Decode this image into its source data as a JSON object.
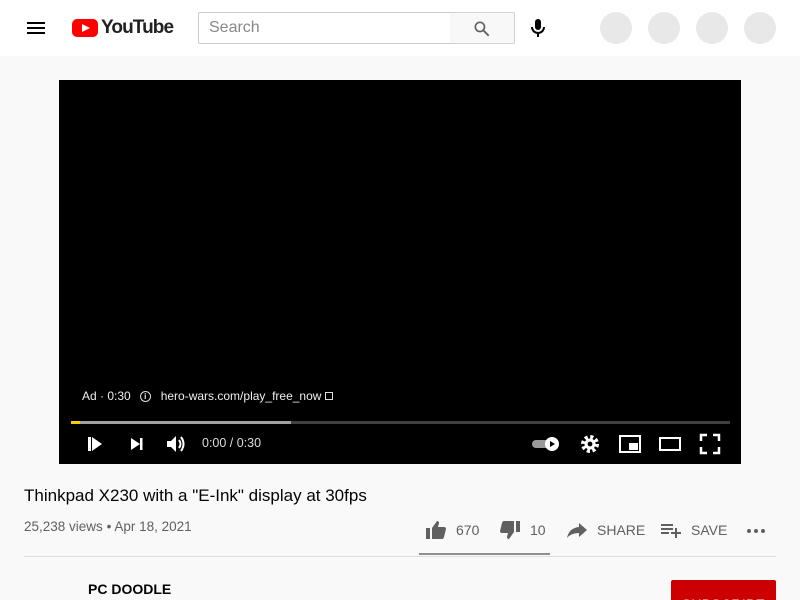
{
  "header": {
    "logo_text": "YouTube",
    "search_placeholder": "Search"
  },
  "player": {
    "ad_label": "Ad · 0:30",
    "ad_link": "hero-wars.com/play_free_now",
    "time_display": "0:00 / 0:30",
    "progress_played_fraction": 0.014,
    "progress_loaded_fraction": 0.334,
    "progress_color": "#ffcc00"
  },
  "video": {
    "title": "Thinkpad X230 with a \"E-Ink\" display at 30fps",
    "views": "25,238 views",
    "date": "Apr 18, 2021"
  },
  "actions": {
    "likes": "670",
    "dislikes": "10",
    "share": "SHARE",
    "save": "SAVE"
  },
  "channel": {
    "name": "PC DOODLE",
    "subscribe_label": "SUBSCRIBE",
    "subscribe_color": "#cc0000"
  }
}
